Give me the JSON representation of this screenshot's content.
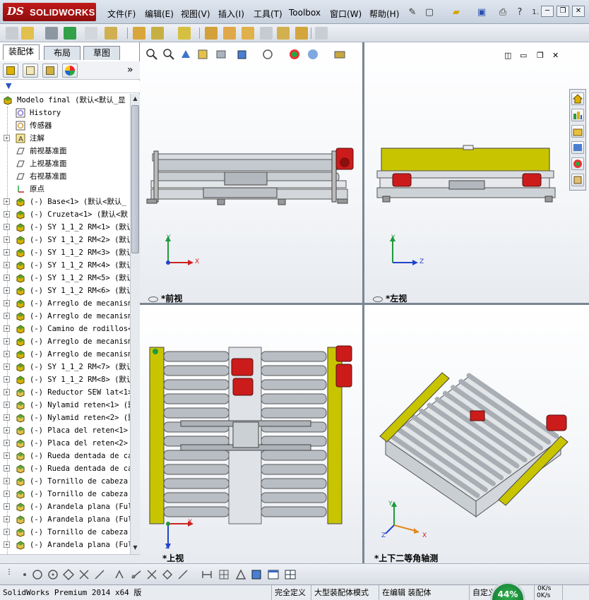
{
  "app": {
    "logo_ds": "DS",
    "logo_name": "SOLIDWORKS",
    "menus": [
      "文件(F)",
      "编辑(E)",
      "视图(V)",
      "插入(I)",
      "工具(T)",
      "Toolbox",
      "窗口(W)",
      "帮助(H)"
    ],
    "help_small": "1.",
    "window_min": "─",
    "window_restore": "❐",
    "window_close": "✕"
  },
  "panel": {
    "tabs": [
      "装配体",
      "布局",
      "草图"
    ],
    "active_tab": 0,
    "more": "»",
    "filter_icon": "filter-icon",
    "tree": [
      {
        "label": "Modelo final  (默认<默认_显",
        "icon": "assembly-icon",
        "exp": "",
        "indent": 0
      },
      {
        "label": "History",
        "icon": "history-icon",
        "exp": "",
        "indent": 1
      },
      {
        "label": "传感器",
        "icon": "sensor-icon",
        "exp": "",
        "indent": 1
      },
      {
        "label": "注解",
        "icon": "annotation-icon",
        "exp": "+",
        "indent": 1
      },
      {
        "label": "前视基准面",
        "icon": "plane-icon",
        "exp": "",
        "indent": 1
      },
      {
        "label": "上视基准面",
        "icon": "plane-icon",
        "exp": "",
        "indent": 1
      },
      {
        "label": "右视基准面",
        "icon": "plane-icon",
        "exp": "",
        "indent": 1
      },
      {
        "label": "原点",
        "icon": "origin-icon",
        "exp": "",
        "indent": 1
      },
      {
        "label": "(-) Base<1> (默认<默认_",
        "icon": "subassembly-icon",
        "exp": "+",
        "indent": 1
      },
      {
        "label": "(-) Cruzeta<1> (默认<默",
        "icon": "subassembly-icon",
        "exp": "+",
        "indent": 1
      },
      {
        "label": "(-) SY 1_1_2 RM<1> (默认",
        "icon": "subassembly-icon",
        "exp": "+",
        "indent": 1
      },
      {
        "label": "(-) SY 1_1_2 RM<2> (默认",
        "icon": "subassembly-icon",
        "exp": "+",
        "indent": 1
      },
      {
        "label": "(-) SY 1_1_2 RM<3> (默认",
        "icon": "subassembly-icon",
        "exp": "+",
        "indent": 1
      },
      {
        "label": "(-) SY 1_1_2 RM<4> (默认",
        "icon": "subassembly-icon",
        "exp": "+",
        "indent": 1
      },
      {
        "label": "(-) SY 1_1_2 RM<5> (默认",
        "icon": "subassembly-icon",
        "exp": "+",
        "indent": 1
      },
      {
        "label": "(-) SY 1_1_2 RM<6> (默认",
        "icon": "subassembly-icon",
        "exp": "+",
        "indent": 1
      },
      {
        "label": "(-) Arreglo de mecanism",
        "icon": "subassembly-icon",
        "exp": "+",
        "indent": 1
      },
      {
        "label": "(-) Arreglo de mecanism",
        "icon": "subassembly-icon",
        "exp": "+",
        "indent": 1
      },
      {
        "label": "(-) Camino de rodillos<",
        "icon": "subassembly-icon",
        "exp": "+",
        "indent": 1
      },
      {
        "label": "(-) Arreglo de mecanism",
        "icon": "subassembly-icon",
        "exp": "+",
        "indent": 1
      },
      {
        "label": "(-) Arreglo de mecanism",
        "icon": "subassembly-icon",
        "exp": "+",
        "indent": 1
      },
      {
        "label": "(-) SY 1_1_2 RM<7> (默认",
        "icon": "subassembly-icon",
        "exp": "+",
        "indent": 1
      },
      {
        "label": "(-) SY 1_1_2 RM<8> (默认",
        "icon": "subassembly-icon",
        "exp": "+",
        "indent": 1
      },
      {
        "label": "(-) Reductor SEW lat<1>",
        "icon": "part-icon",
        "exp": "+",
        "indent": 1
      },
      {
        "label": "(-) Nylamid reten<1> (默",
        "icon": "part-icon",
        "exp": "+",
        "indent": 1
      },
      {
        "label": "(-) Nylamid reten<2> (默",
        "icon": "part-icon",
        "exp": "+",
        "indent": 1
      },
      {
        "label": "(-) Placa del reten<1>",
        "icon": "part-icon",
        "exp": "+",
        "indent": 1
      },
      {
        "label": "(-) Placa del reten<2>",
        "icon": "part-icon",
        "exp": "+",
        "indent": 1
      },
      {
        "label": "(-) Rueda dentada de ca",
        "icon": "part-icon",
        "exp": "+",
        "indent": 1
      },
      {
        "label": "(-) Rueda dentada de ca",
        "icon": "part-icon",
        "exp": "+",
        "indent": 1
      },
      {
        "label": "(-) Tornillo de cabeza",
        "icon": "part-icon",
        "exp": "+",
        "indent": 1
      },
      {
        "label": "(-) Tornillo de cabeza",
        "icon": "part-icon",
        "exp": "+",
        "indent": 1
      },
      {
        "label": "(-) Arandela plana (Ful",
        "icon": "part-icon",
        "exp": "+",
        "indent": 1
      },
      {
        "label": "(-) Arandela plana (Ful",
        "icon": "part-icon",
        "exp": "+",
        "indent": 1
      },
      {
        "label": "(-) Tornillo de cabeza",
        "icon": "part-icon",
        "exp": "+",
        "indent": 1
      },
      {
        "label": "(-) Arandela plana (Ful",
        "icon": "part-icon",
        "exp": "+",
        "indent": 1
      }
    ]
  },
  "views": [
    {
      "label": "*前视",
      "axes": [
        "Y",
        "X"
      ]
    },
    {
      "label": "*左视",
      "axes": [
        "Y",
        "Z"
      ]
    },
    {
      "label": "*上视",
      "axes": [
        "X",
        "Z"
      ]
    },
    {
      "label": "*上下二等角轴测",
      "axes": [
        "Y",
        "X",
        "Z"
      ]
    }
  ],
  "status": {
    "app_version": "SolidWorks Premium 2014 x64 版",
    "fully_defined": "完全定义",
    "large_assembly": "大型装配体模式",
    "editing": "在编辑 装配体",
    "custom": "自定义",
    "progress": "44%",
    "net_speed": "0K/s",
    "net_speed2": "0K/s"
  },
  "colors": {
    "frame_yellow": "#c8c400",
    "motor_red": "#cc1b1b",
    "roller_grey": "#b9bec4",
    "axis_x": "#cc2222",
    "axis_y": "#1f9a3a",
    "axis_z": "#2244cc"
  }
}
